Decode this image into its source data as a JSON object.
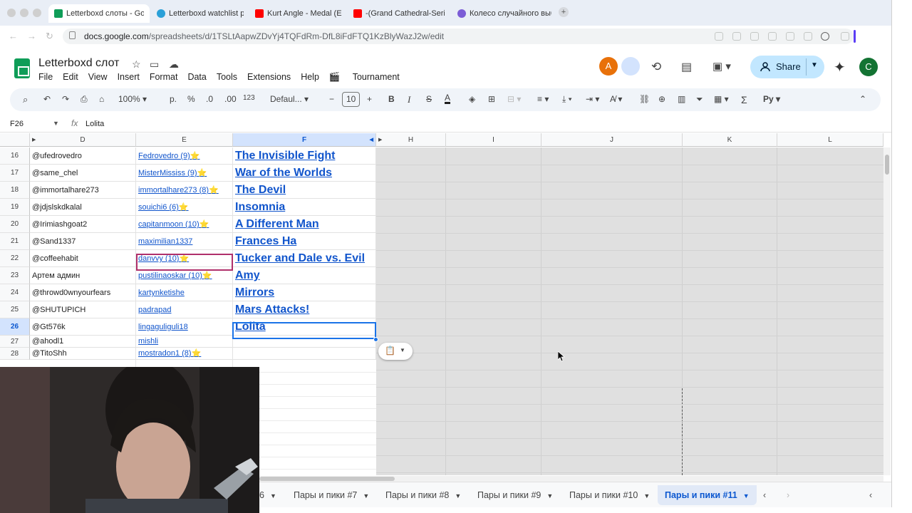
{
  "browser": {
    "tabs": [
      {
        "title": "Letterboxd слоты - Goo",
        "color": "#0f9d58"
      },
      {
        "title": "Letterboxd watchlist pic",
        "color": "#2aa0d8"
      },
      {
        "title": "Kurt Angle - Medal (Entr",
        "color": "#ff0000"
      },
      {
        "title": "-(Grand Cathedral-Serio",
        "color": "#ff0000"
      },
      {
        "title": "Колесо случайного выб",
        "color": "#7b5cd6"
      }
    ],
    "new_tab": "+",
    "url_host": "docs.google.com",
    "url_path": "/spreadsheets/d/1TSLtAapwZDvYj4TQFdRm-DfL8iFdFTQ1KzBlyWazJ2w/edit"
  },
  "sheets": {
    "title": "Letterboxd слот",
    "menu": [
      "File",
      "Edit",
      "View",
      "Insert",
      "Format",
      "Data",
      "Tools",
      "Extensions",
      "Help",
      "Tournament"
    ],
    "tournament_icon": "🎬",
    "avatar_a": "A",
    "avatar_c": "C",
    "share_label": "Share",
    "toolbar": {
      "zoom": "100%",
      "currency": "р.",
      "percent": "%",
      "dec_less": ".0",
      "dec_more": ".00",
      "number_fmt": "123",
      "font": "Defaul...",
      "font_size": "10",
      "bold": "B",
      "italic": "I",
      "strike": "S",
      "text_color": "A",
      "sum": "Σ",
      "input_tools": "Py"
    },
    "name_box": "F26",
    "fx": "fx",
    "formula_value": "Lolita"
  },
  "grid": {
    "columns": [
      "D",
      "E",
      "F",
      "H",
      "I",
      "J",
      "K",
      "L"
    ],
    "rows": [
      {
        "n": "16",
        "d": "@ufedrovedro",
        "e": "Fedrovedro (9)⭐",
        "f": "The Invisible Fight"
      },
      {
        "n": "17",
        "d": "@same_chel",
        "e": "MisterMississ (9)⭐",
        "f": "War of the Worlds"
      },
      {
        "n": "18",
        "d": "@immortalhare273",
        "e": "immortalhare273 (8)⭐",
        "f": "The Devil"
      },
      {
        "n": "19",
        "d": "@jdjslskdkalal",
        "e": "souichi6 (6)⭐",
        "f": "Insomnia"
      },
      {
        "n": "20",
        "d": "@Irimiashgoat2",
        "e": "capitanmoon (10)⭐",
        "f": "A Different Man"
      },
      {
        "n": "21",
        "d": "@Sand1337",
        "e": "maximilian1337",
        "f": "Frances Ha"
      },
      {
        "n": "22",
        "d": "@coffeehabit",
        "e": "danvvy (10)⭐",
        "f": "Tucker and Dale vs. Evil"
      },
      {
        "n": "23",
        "d": "Артем админ",
        "e": "pustilinaoskar (10)⭐",
        "f": "Amy"
      },
      {
        "n": "24",
        "d": "@throwd0wnyourfears",
        "e": "kartynketishe",
        "f": "Mirrors"
      },
      {
        "n": "25",
        "d": "@SHUTUPICH",
        "e": "padrapad",
        "f": "Mars Attacks!"
      },
      {
        "n": "26",
        "d": "@Gt576k",
        "e": "lingaguliguli18",
        "f": "Lolita"
      },
      {
        "n": "27",
        "d": "@ahodl1",
        "e": "mishli",
        "f": ""
      },
      {
        "n": "28",
        "d": "@TitoShh",
        "e": "mostradon1 (8)⭐",
        "f": ""
      }
    ]
  },
  "sheet_tabs": [
    {
      "label": "6",
      "active": false
    },
    {
      "label": "Пары и пики #7",
      "active": false
    },
    {
      "label": "Пары и пики #8",
      "active": false
    },
    {
      "label": "Пары и пики #9",
      "active": false
    },
    {
      "label": "Пары и пики #10",
      "active": false
    },
    {
      "label": "Пары и пики #11",
      "active": true
    }
  ]
}
